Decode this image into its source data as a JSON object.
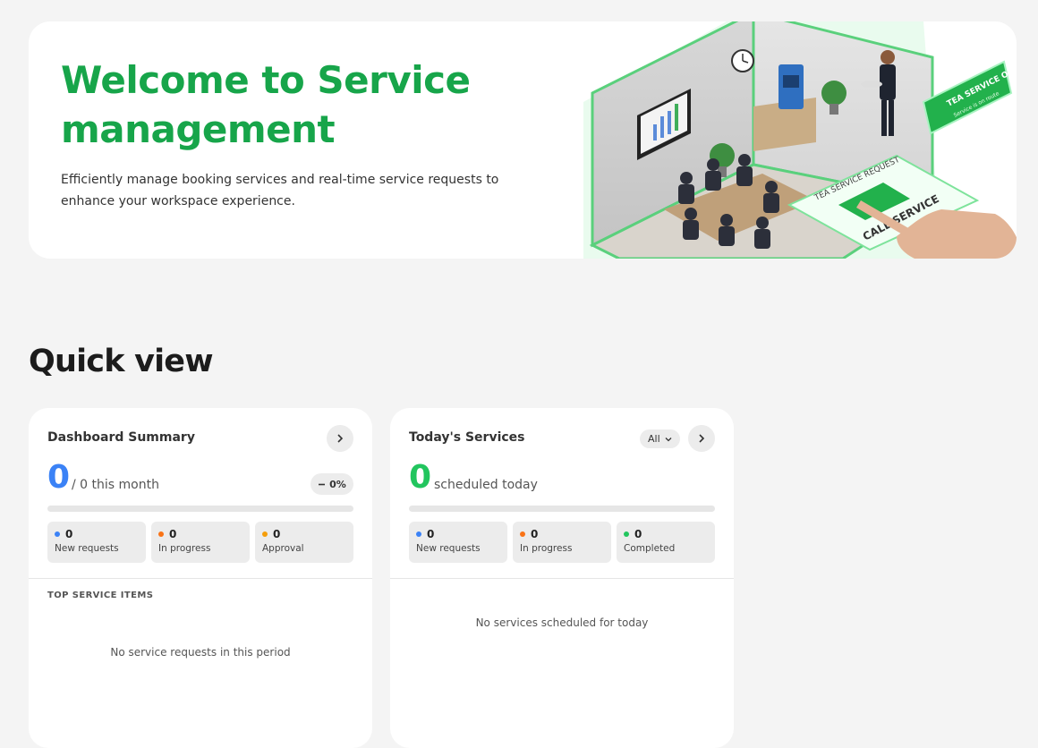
{
  "hero": {
    "title": "Welcome to Service management",
    "description": "Efficiently manage booking services and real-time service requests to enhance your workspace experience.",
    "illustration": {
      "sign_tea_service_request": "TEA SERVICE REQUEST",
      "sign_call_service": "CALL SERVICE",
      "sign_tea_service_ordered": "TEA SERVICE ORDERED",
      "sign_ordered_subtext": "Service is on route"
    }
  },
  "quick_view": {
    "title": "Quick view"
  },
  "dashboard_summary": {
    "title": "Dashboard Summary",
    "next_icon": "chevron-right-icon",
    "count": "0",
    "month_text": "/ 0 this month",
    "change_icon": "minus-icon",
    "change_pct": "0%",
    "progress_fraction": 0,
    "stats": [
      {
        "value": "0",
        "label": "New requests",
        "color": "#3b82f6"
      },
      {
        "value": "0",
        "label": "In progress",
        "color": "#f97316"
      },
      {
        "value": "0",
        "label": "Approval",
        "color": "#f59e0b"
      }
    ],
    "top_items_heading": "TOP SERVICE ITEMS",
    "empty_message": "No service requests in this period"
  },
  "todays_services": {
    "title": "Today's Services",
    "filter_value": "All",
    "filter_icon": "chevron-down-icon",
    "next_icon": "chevron-right-icon",
    "count": "0",
    "scheduled_text": "scheduled today",
    "progress_fraction": 0,
    "stats": [
      {
        "value": "0",
        "label": "New requests",
        "color": "#3b82f6"
      },
      {
        "value": "0",
        "label": "In progress",
        "color": "#f97316"
      },
      {
        "value": "0",
        "label": "Completed",
        "color": "#22c55e"
      }
    ],
    "empty_message": "No services scheduled for today"
  },
  "colors": {
    "brand_green": "#17a54a",
    "accent_blue": "#3b82f6",
    "accent_green": "#22c55e"
  }
}
